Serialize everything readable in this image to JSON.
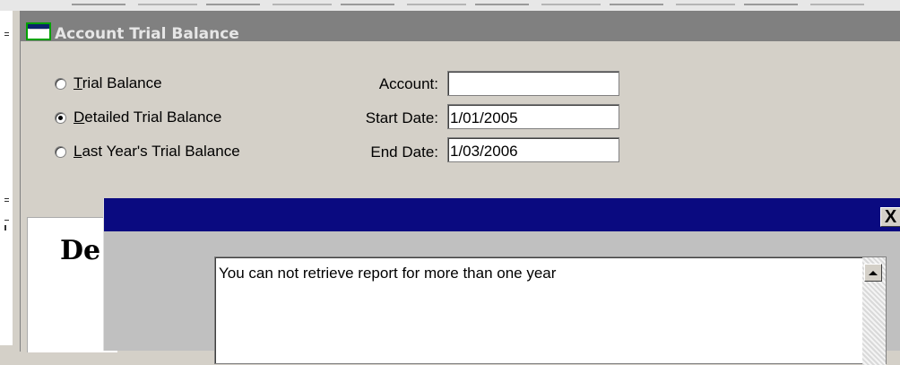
{
  "window": {
    "title": "Account Trial Balance"
  },
  "report_types": [
    {
      "label_mnemonic": "T",
      "label_rest": "rial Balance",
      "checked": false
    },
    {
      "label_mnemonic": "D",
      "label_rest": "etailed Trial Balance",
      "checked": true
    },
    {
      "label_mnemonic": "L",
      "label_rest": "ast Year's Trial Balance",
      "checked": false
    }
  ],
  "fields": {
    "account": {
      "label": "Account:",
      "value": ""
    },
    "start_date": {
      "label": "Start Date:",
      "value": "1/01/2005"
    },
    "end_date": {
      "label": "End Date:",
      "value": "1/03/2006"
    }
  },
  "report": {
    "heading_partial": "De"
  },
  "dialog": {
    "close_label": "X",
    "message": "You can not retrieve report for more than one year"
  }
}
